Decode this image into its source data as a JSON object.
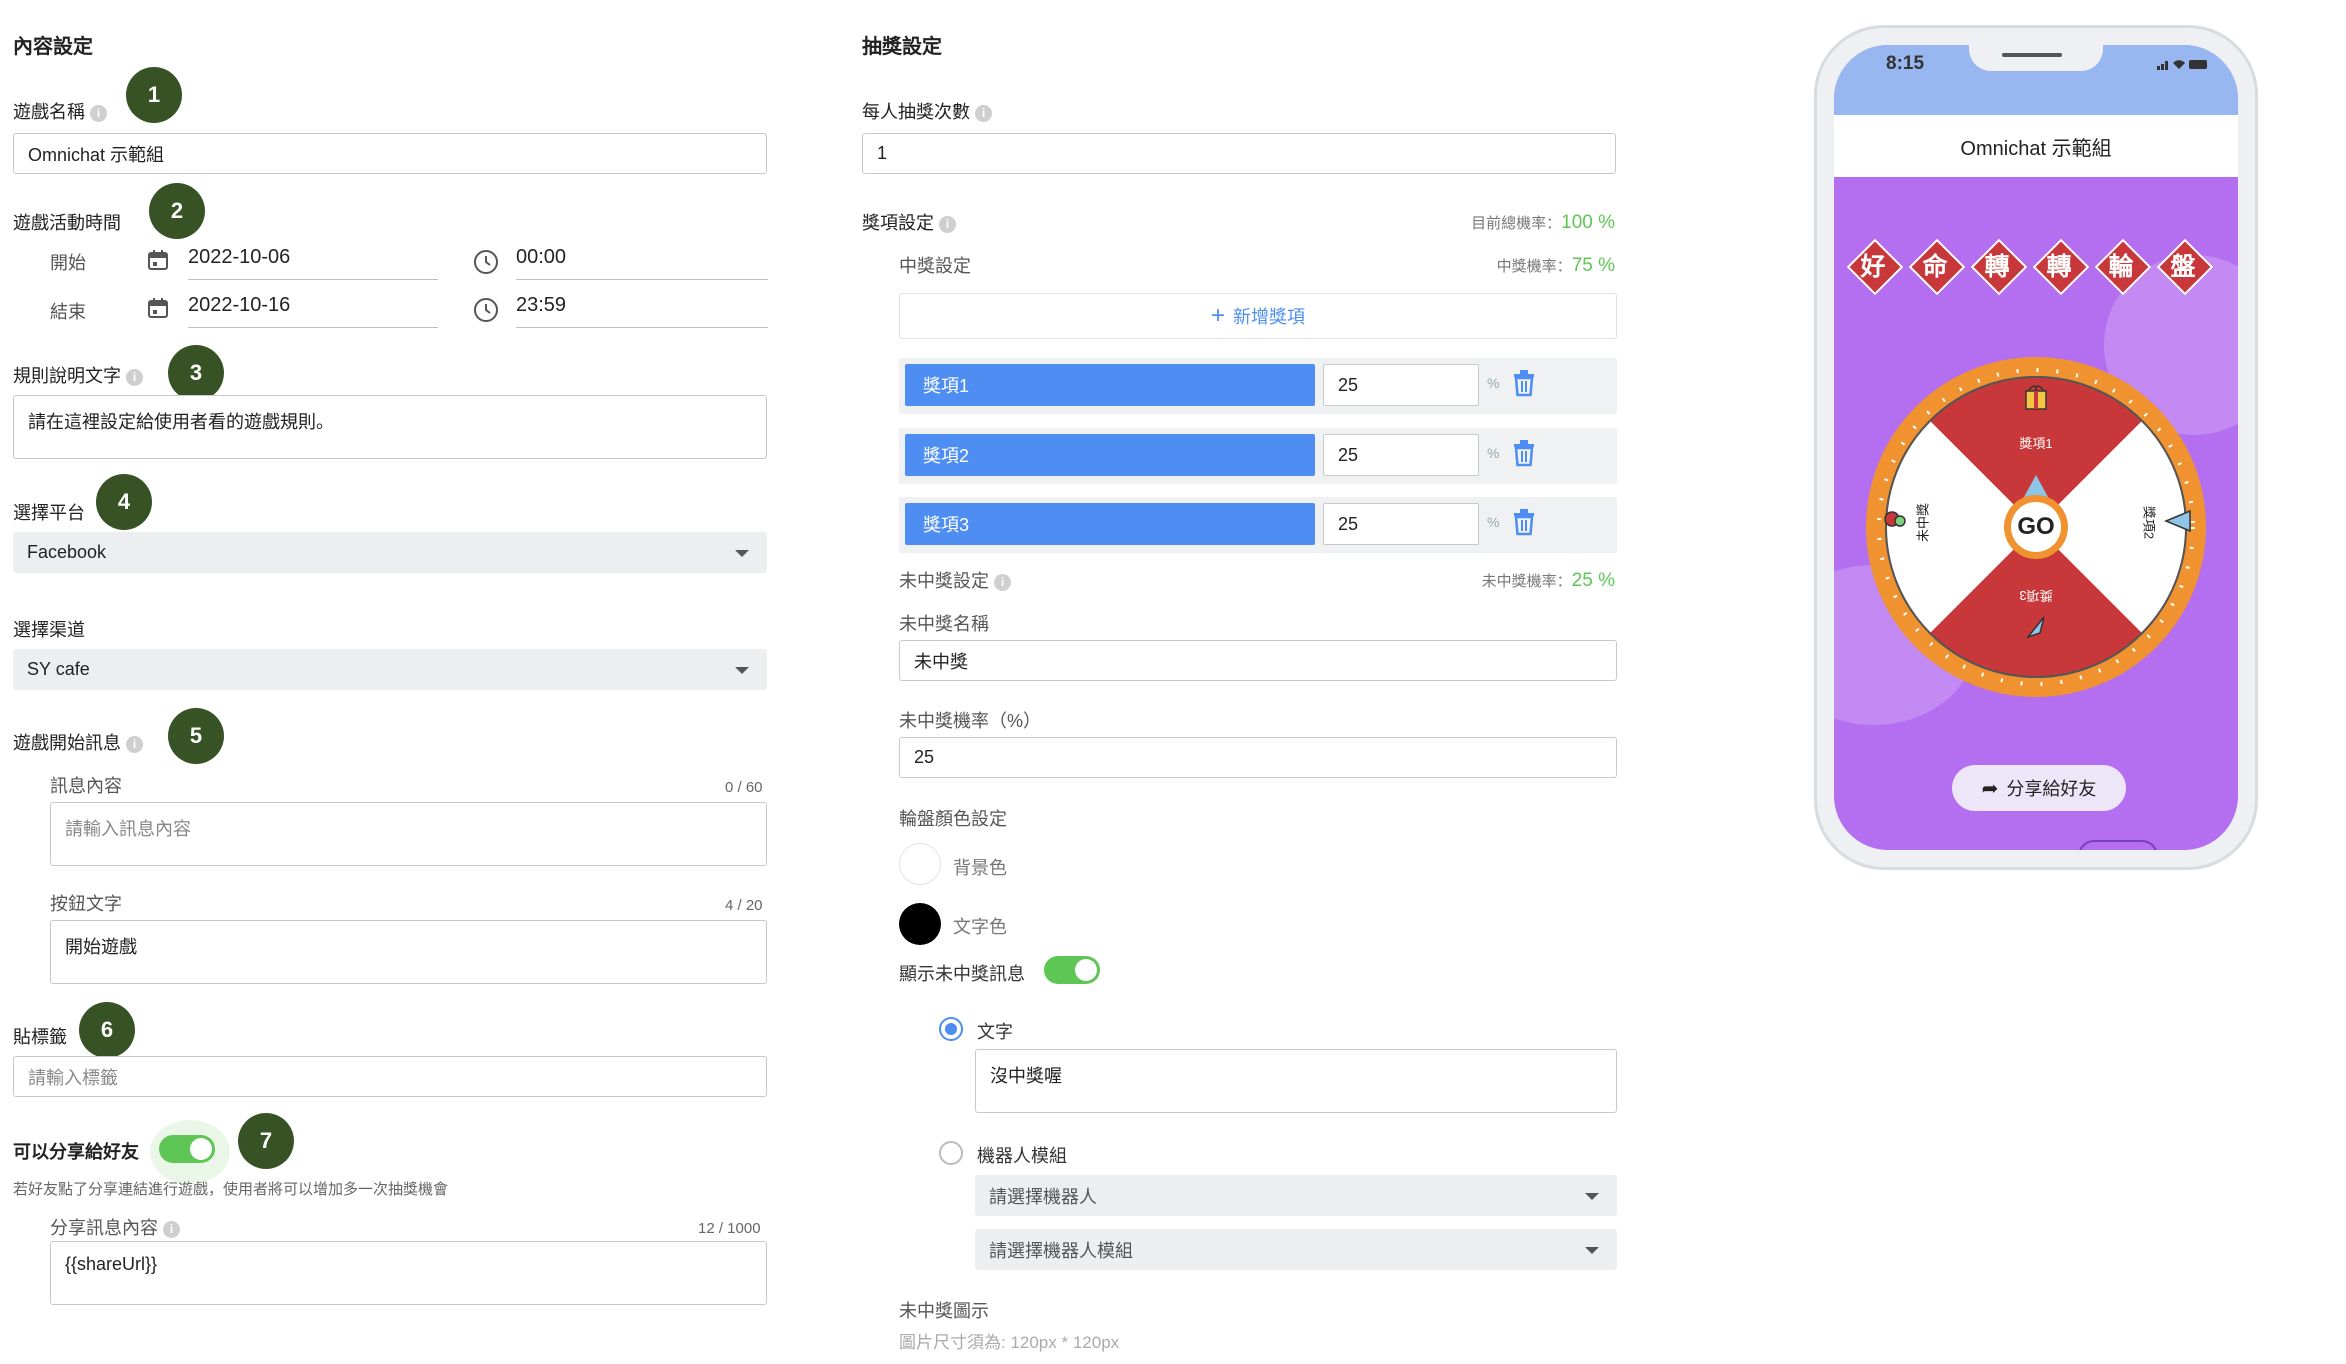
{
  "left": {
    "section_title": "內容設定",
    "game_name": {
      "label": "遊戲名稱",
      "value": "Omnichat 示範組",
      "badge": "1"
    },
    "time": {
      "label": "遊戲活動時間",
      "badge": "2",
      "start_label": "開始",
      "end_label": "結束",
      "start_date": "2022-10-06",
      "start_time": "00:00",
      "end_date": "2022-10-16",
      "end_time": "23:59"
    },
    "rules": {
      "label": "規則說明文字",
      "badge": "3",
      "value": "請在這裡設定給使用者看的遊戲規則。"
    },
    "platform": {
      "label": "選擇平台",
      "badge": "4",
      "value": "Facebook"
    },
    "channel": {
      "label": "選擇渠道",
      "value": "SY cafe"
    },
    "start_msg": {
      "label": "遊戲開始訊息",
      "badge": "5",
      "content_label": "訊息內容",
      "content_count": "0 / 60",
      "content_placeholder": "請輸入訊息內容",
      "button_label": "按鈕文字",
      "button_count": "4 / 20",
      "button_value": "開始遊戲"
    },
    "tags": {
      "label": "貼標籤",
      "badge": "6",
      "placeholder": "請輸入標籤"
    },
    "share": {
      "label": "可以分享給好友",
      "badge": "7",
      "hint": "若好友點了分享連結進行遊戲，使用者將可以增加多一次抽獎機會",
      "content_label": "分享訊息內容",
      "content_count": "12 / 1000",
      "content_value": "{{shareUrl}}"
    }
  },
  "middle": {
    "section_title": "抽獎設定",
    "draws": {
      "label": "每人抽獎次數",
      "value": "1"
    },
    "prize_settings": {
      "label": "獎項設定",
      "total_rate_label": "目前總機率：",
      "total_rate_value": "100 %"
    },
    "winning": {
      "label": "中獎設定",
      "rate_label": "中獎機率：",
      "rate_value": "75 %",
      "add_button": "新增獎項"
    },
    "prizes": [
      {
        "name": "獎項1",
        "value": "25",
        "unit": "%"
      },
      {
        "name": "獎項2",
        "value": "25",
        "unit": "%"
      },
      {
        "name": "獎項3",
        "value": "25",
        "unit": "%"
      }
    ],
    "no_prize": {
      "label": "未中獎設定",
      "rate_label": "未中獎機率：",
      "rate_value": "25 %",
      "name_label": "未中獎名稱",
      "name_value": "未中獎",
      "rate_input_label": "未中獎機率（%）",
      "rate_input_value": "25"
    },
    "wheel_colors": {
      "label": "輪盤顏色設定",
      "bg_label": "背景色",
      "text_label": "文字色"
    },
    "show_no_prize": {
      "label": "顯示未中獎訊息",
      "text_option": "文字",
      "text_value": "沒中獎喔",
      "bot_option": "機器人模組",
      "bot_placeholder": "請選擇機器人",
      "bot_module_placeholder": "請選擇機器人模組"
    },
    "no_prize_icon": {
      "label": "未中獎圖示",
      "hint": "圖片尺寸須為: 120px * 120px"
    }
  },
  "phone": {
    "time": "8:15",
    "title": "Omnichat 示範組",
    "banner": [
      "好",
      "命",
      "轉",
      "轉",
      "輪",
      "盤"
    ],
    "wheel_labels": [
      "獎項1",
      "獎項2",
      "獎項3",
      "未中獎"
    ],
    "go": "GO",
    "share_button": "分享給好友"
  },
  "colors": {
    "accent": "#4e8ef2",
    "badge": "#375224",
    "green": "#5ec654",
    "wheel_red": "#c8383a",
    "wheel_ring": "#f0922f",
    "phone_bg": "#b46ef0"
  }
}
